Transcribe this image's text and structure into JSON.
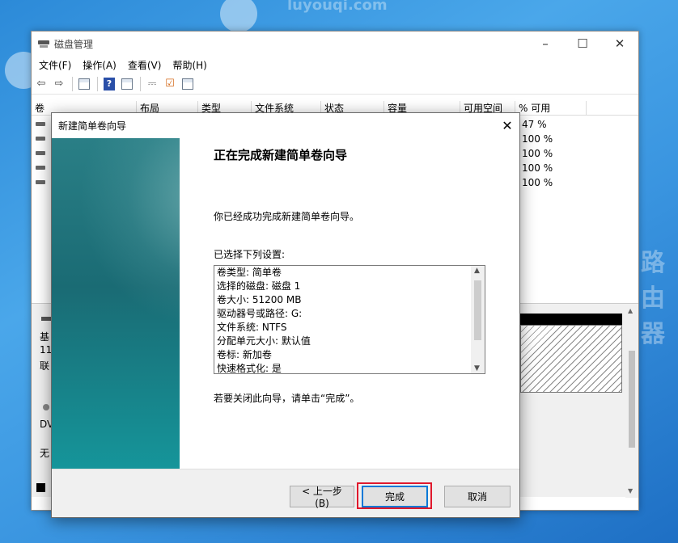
{
  "window": {
    "title": "磁盘管理"
  },
  "menu": [
    "文件(F)",
    "操作(A)",
    "查看(V)",
    "帮助(H)"
  ],
  "toolbar_icons": [
    "back-arrow-icon",
    "forward-arrow-icon",
    "properties-sheet-icon",
    "help-icon",
    "snapin-sheet-icon",
    "connect-icon",
    "check-icon",
    "list-sheet-icon"
  ],
  "volume_list": {
    "columns": [
      "卷",
      "布局",
      "类型",
      "文件系统",
      "状态",
      "容量",
      "可用空间",
      "% 可用"
    ],
    "rows": [
      {
        "pct": "47 %"
      },
      {
        "pct": "100 %"
      },
      {
        "pct": "100 %"
      },
      {
        "pct": "100 %"
      },
      {
        "pct": "100 %"
      }
    ]
  },
  "disk_panel": {
    "disk0_lines": [
      "基",
      "11",
      "联"
    ],
    "dvd_lines": [
      "DV",
      "无"
    ]
  },
  "wizard": {
    "title": "新建简单卷向导",
    "heading": "正在完成新建简单卷向导",
    "intro": "你已经成功完成新建简单卷向导。",
    "settings_label": "已选择下列设置:",
    "settings": [
      "卷类型: 简单卷",
      "选择的磁盘: 磁盘 1",
      "卷大小: 51200 MB",
      "驱动器号或路径: G:",
      "文件系统: NTFS",
      "分配单元大小: 默认值",
      "卷标: 新加卷",
      "快速格式化: 是"
    ],
    "close_hint": "若要关闭此向导，请单击“完成”。",
    "buttons": {
      "back": "< 上一步(B)",
      "finish": "完成",
      "cancel": "取消"
    }
  },
  "watermark": [
    "luyouqi.com",
    "路由器"
  ],
  "colors": {
    "highlight": "#e0192d",
    "focus": "#0078d7",
    "wizard_sidebar": "#1a6b74"
  }
}
